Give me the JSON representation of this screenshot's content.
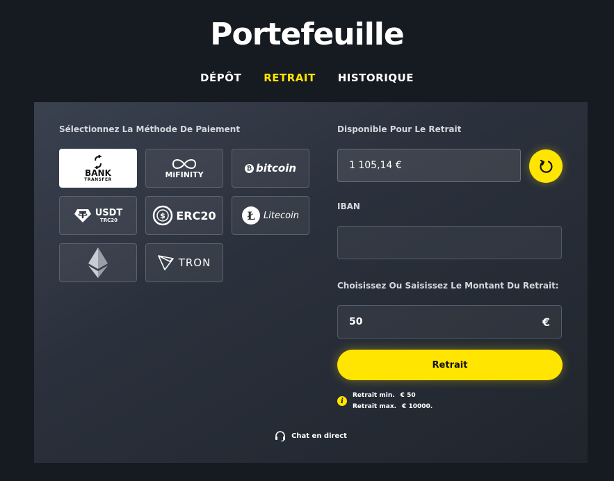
{
  "page": {
    "title": "Portefeuille"
  },
  "tabs": [
    {
      "label": "DÉPÔT",
      "active": false
    },
    {
      "label": "RETRAIT",
      "active": true
    },
    {
      "label": "HISTORIQUE",
      "active": false
    }
  ],
  "payment": {
    "label": "Sélectionnez La Méthode De Paiement",
    "methods": [
      {
        "name": "bank-transfer",
        "line1": "BANK",
        "line2": "TRANSFER",
        "selected": true
      },
      {
        "name": "mifinity",
        "text": "MiFINITY",
        "selected": false
      },
      {
        "name": "bitcoin",
        "text": "bitcoin",
        "selected": false
      },
      {
        "name": "usdt-trc20",
        "line1": "USDT",
        "line2": "TRC20",
        "selected": false
      },
      {
        "name": "erc20",
        "text": "ERC20",
        "selected": false
      },
      {
        "name": "litecoin",
        "text": "Litecoin",
        "selected": false
      },
      {
        "name": "ethereum",
        "selected": false
      },
      {
        "name": "tron",
        "text": "TRON",
        "selected": false
      }
    ]
  },
  "available": {
    "label": "Disponible Pour Le Retrait",
    "value": "1 105,14 €"
  },
  "iban": {
    "label": "IBAN",
    "value": ""
  },
  "amount": {
    "label": "Choisissez Ou Saisissez Le Montant Du Retrait:",
    "value": "50",
    "currency": "€"
  },
  "submit": {
    "label": "Retrait"
  },
  "limits": {
    "min_label": "Retrait min.",
    "min_value": "€ 50",
    "max_label": "Retrait max.",
    "max_value": "€ 10000."
  },
  "chat": {
    "label": "Chat en direct"
  },
  "colors": {
    "accent": "#ffe500",
    "background": "#161a21",
    "panel": "#2b313c"
  },
  "icons": {
    "refresh": "refresh-icon",
    "info": "info-icon",
    "chat": "headset-icon"
  }
}
